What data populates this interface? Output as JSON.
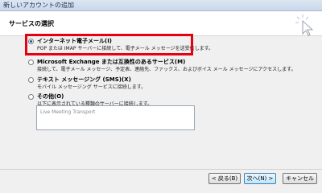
{
  "window": {
    "title": "新しいアカウントの追加"
  },
  "header": {
    "heading": "サービスの選択"
  },
  "options": [
    {
      "label": "インターネット電子メール(I)",
      "description": "POP または IMAP サーバーに接続して、電子メール メッセージを送受信します。",
      "checked": true
    },
    {
      "label": "Microsoft Exchange または互換性のあるサービス(M)",
      "description": "接続して、電子メール メッセージ、予定表、連絡先、ファックス、およびボイス メール メッセージにアクセスします。",
      "checked": false
    },
    {
      "label": "テキスト メッセージング (SMS)(X)",
      "description": "モバイル メッセージング サービスに接続します。",
      "checked": false
    },
    {
      "label": "その他(O)",
      "description": "以下に表示されている種類のサーバーに接続します。",
      "checked": false
    }
  ],
  "other_list": {
    "items": [
      "Live Meeting Transport"
    ]
  },
  "buttons": {
    "back": "< 戻る(B)",
    "next": "次へ(N) >",
    "cancel": "キャンセル"
  },
  "colors": {
    "highlight": "#e60012",
    "header_bg": "#ffffff",
    "dialog_bg": "#f0f0f0"
  }
}
